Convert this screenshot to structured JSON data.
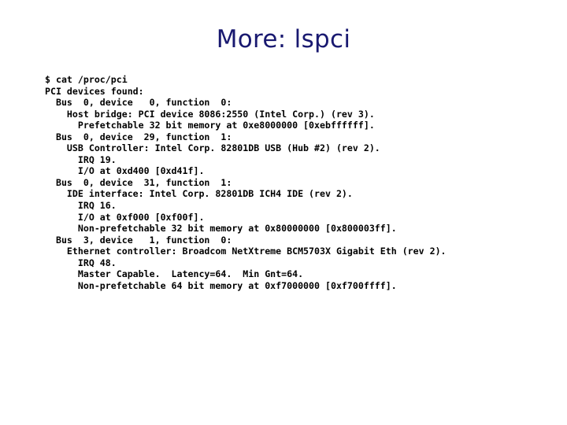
{
  "slide": {
    "title": "More: lspci",
    "title_color": "#191970",
    "background_color": "#ffffff",
    "body_color": "#000000"
  },
  "console": {
    "lines": [
      "$ cat /proc/pci",
      "PCI devices found:",
      "  Bus  0, device   0, function  0:",
      "    Host bridge: PCI device 8086:2550 (Intel Corp.) (rev 3).",
      "      Prefetchable 32 bit memory at 0xe8000000 [0xebffffff].",
      "  Bus  0, device  29, function  1:",
      "    USB Controller: Intel Corp. 82801DB USB (Hub #2) (rev 2).",
      "      IRQ 19.",
      "      I/O at 0xd400 [0xd41f].",
      "  Bus  0, device  31, function  1:",
      "    IDE interface: Intel Corp. 82801DB ICH4 IDE (rev 2).",
      "      IRQ 16.",
      "      I/O at 0xf000 [0xf00f].",
      "      Non-prefetchable 32 bit memory at 0x80000000 [0x800003ff].",
      "  Bus  3, device   1, function  0:",
      "    Ethernet controller: Broadcom NetXtreme BCM5703X Gigabit Eth (rev 2).",
      "      IRQ 48.",
      "      Master Capable.  Latency=64.  Min Gnt=64.",
      "      Non-prefetchable 64 bit memory at 0xf7000000 [0xf700ffff]."
    ]
  }
}
